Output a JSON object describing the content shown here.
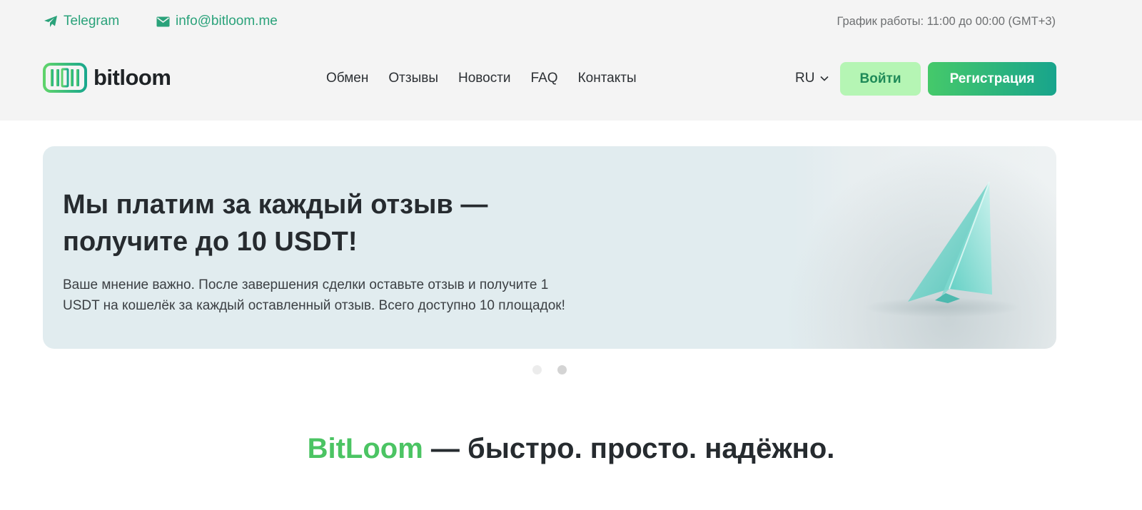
{
  "topbar": {
    "telegram_label": "Telegram",
    "email_label": "info@bitloom.me",
    "schedule": "График работы: 11:00 до 00:00 (GMT+3)"
  },
  "header": {
    "logo_text": "bitloom",
    "nav": [
      "Обмен",
      "Отзывы",
      "Новости",
      "FAQ",
      "Контакты"
    ],
    "language": "RU",
    "login_label": "Войти",
    "register_label": "Регистрация"
  },
  "banner": {
    "title_line1": "Мы платим за каждый отзыв —",
    "title_line2": "получите до 10 USDT!",
    "text_line1": "Ваше мнение важно. После завершения сделки оставьте отзыв и получите 1",
    "text_line2": "USDT на кошелёк за каждый оставленный отзыв. Всего доступно 10 площадок!",
    "slides_total": 2,
    "active_slide": 2
  },
  "slogan": {
    "brand": "BitLoom",
    "rest": " — быстро. просто. надёжно."
  },
  "colors": {
    "accent_green": "#4bc463",
    "contact_green": "#2aa27a",
    "login_bg": "#b5f5b4",
    "register_gradient_start": "#45c96a",
    "register_gradient_end": "#18a48c",
    "header_bg": "#f4f4f4",
    "banner_bg": "#e1ecef"
  },
  "icons": {
    "telegram": "paper-plane-icon",
    "email": "envelope-icon",
    "language": "chevron-down-icon",
    "banner": "glass-paper-plane"
  }
}
